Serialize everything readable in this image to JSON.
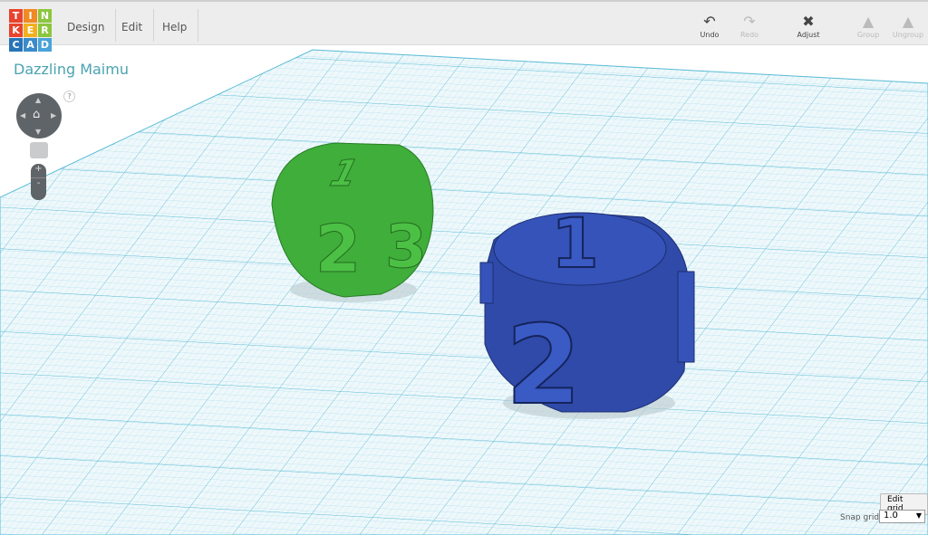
{
  "app": {
    "logo_letters": [
      "T",
      "I",
      "N",
      "K",
      "E",
      "R",
      "C",
      "A",
      "D"
    ],
    "logo_colors": [
      "#e8432e",
      "#f08a24",
      "#8cc63e",
      "#e8432e",
      "#f2b01e",
      "#8cc63e",
      "#2774b8",
      "#3a8bc9",
      "#4aa3d8"
    ]
  },
  "menu": [
    "Design",
    "Edit",
    "Help"
  ],
  "toolbar": {
    "undo": "Undo",
    "redo": "Redo",
    "adjust": "Adjust",
    "group": "Group",
    "ungroup": "Ungroup"
  },
  "design_title": "Dazzling Maimu",
  "view": {
    "help": "?",
    "zoom_in": "+",
    "zoom_out": "-"
  },
  "grid": {
    "edit_label": "Edit grid",
    "snap_label": "Snap grid",
    "snap_value": "1.0"
  },
  "scene": {
    "green_die_faces": [
      "1",
      "2",
      "3"
    ],
    "blue_die_faces": [
      "1",
      "2"
    ],
    "colors": {
      "green": "#3fae3a",
      "blue": "#2f4aa8",
      "grid": "#5bbcd6"
    }
  }
}
